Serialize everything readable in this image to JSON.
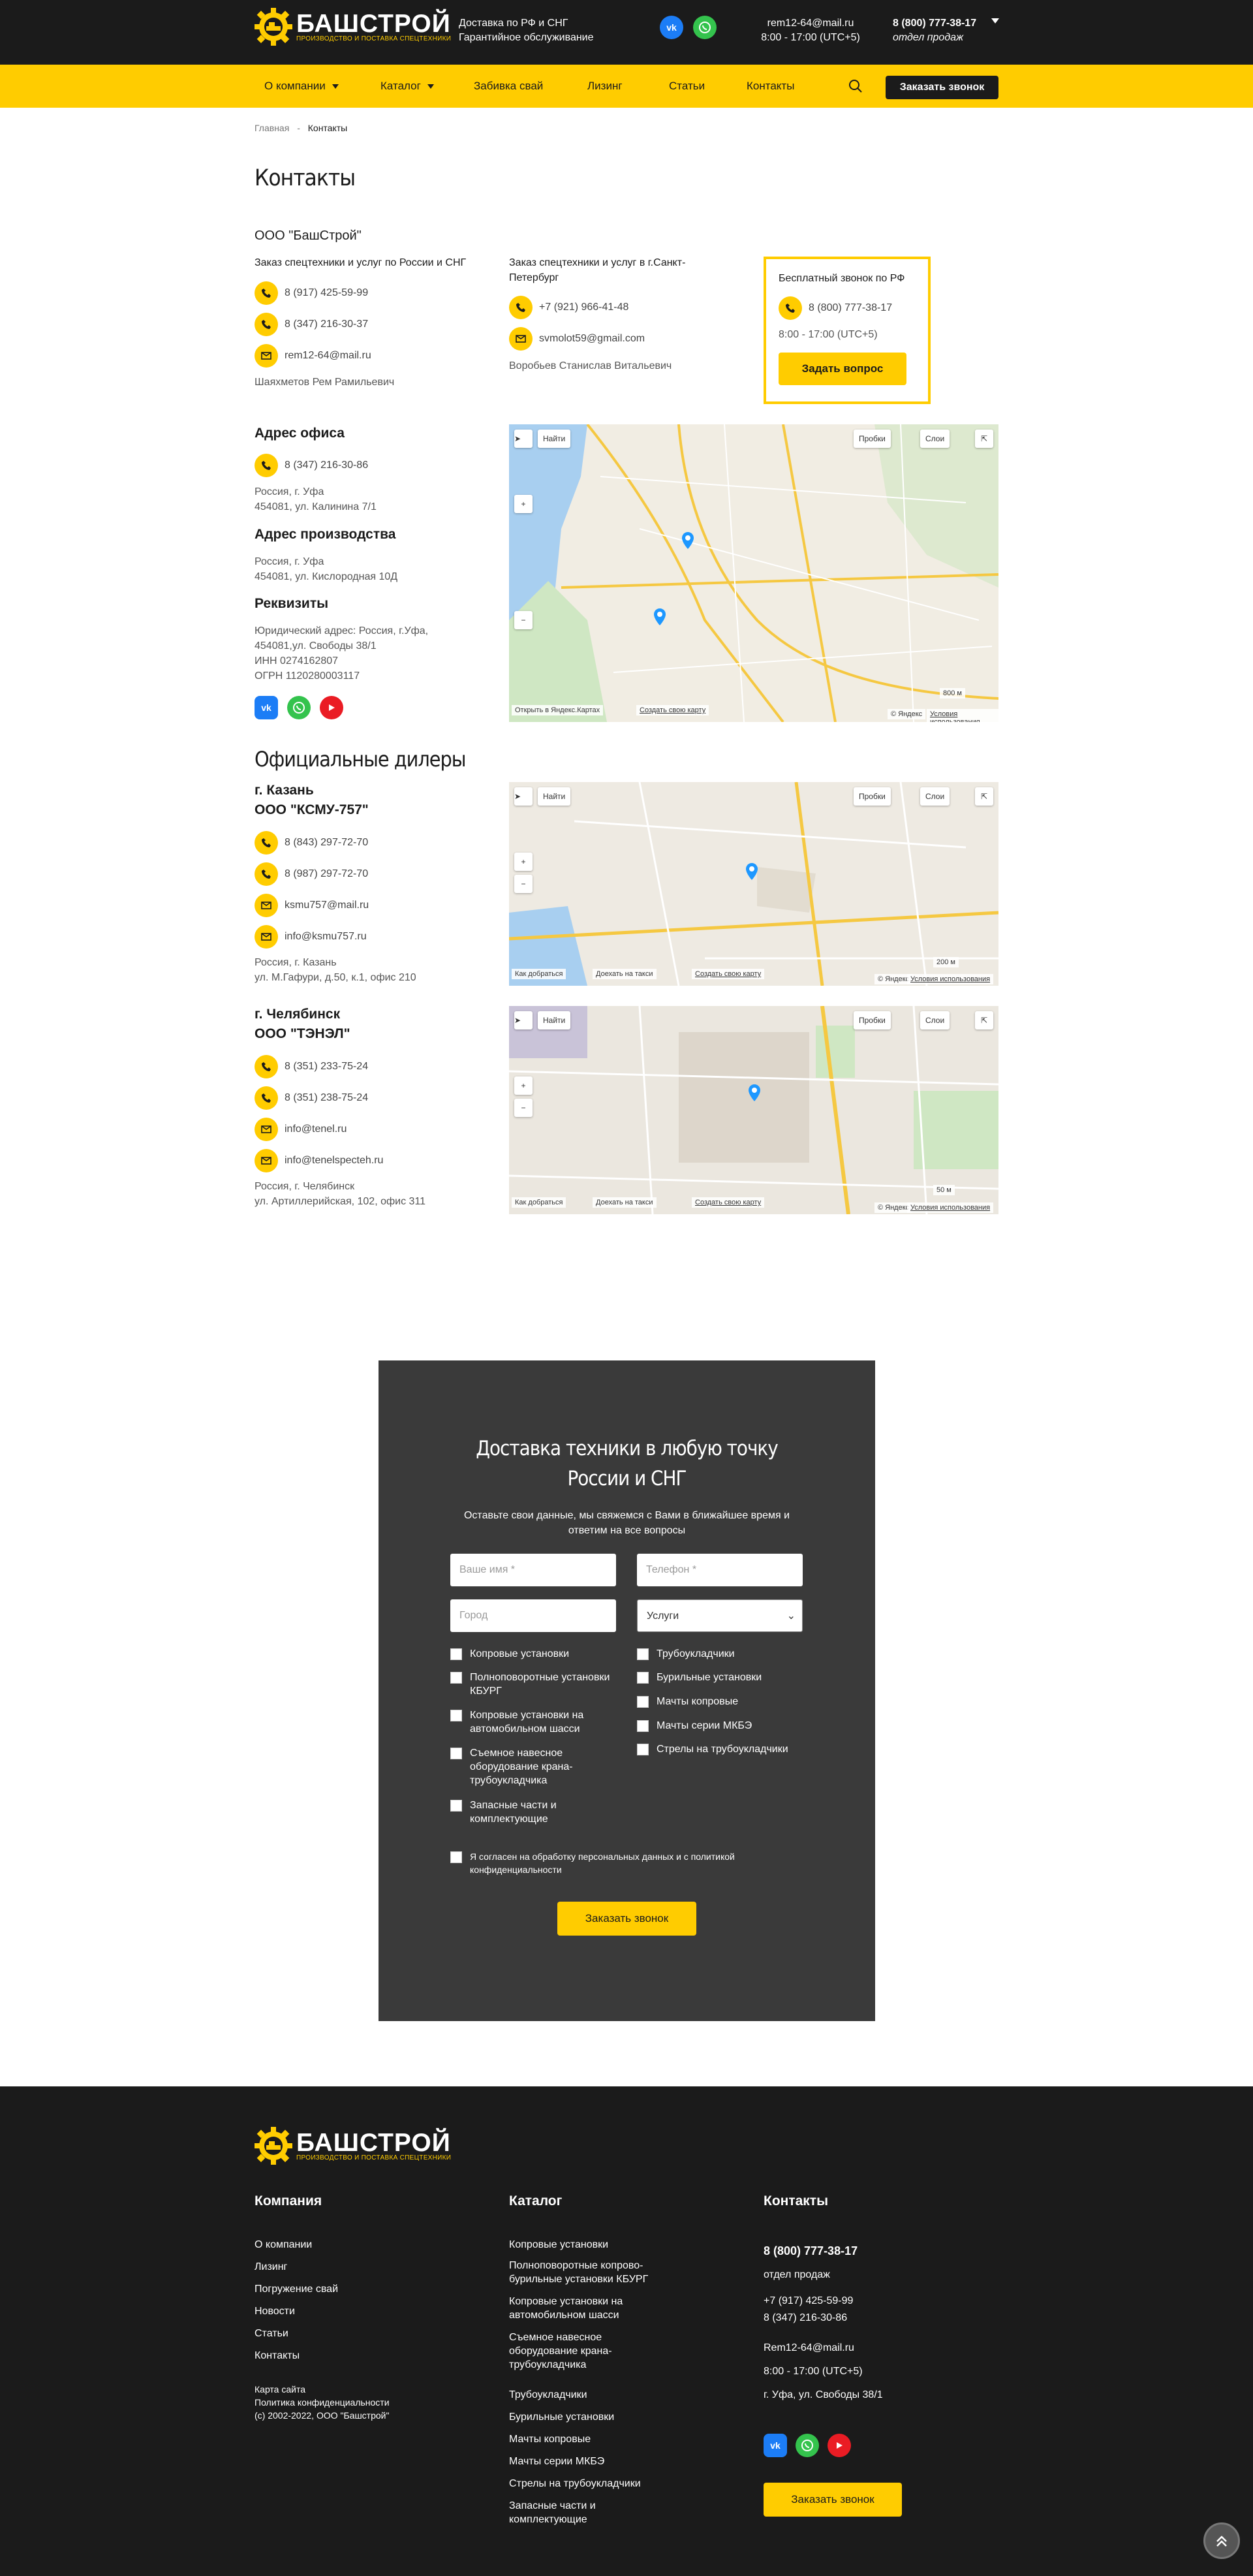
{
  "brand": {
    "name": "БАШСТРОЙ",
    "tagline": "ПРОИЗВОДСТВО И ПОСТАВКА СПЕЦТЕХНИКИ",
    "accent": "#ffcc00",
    "dark": "#1b1b1b"
  },
  "header": {
    "delivery_line1": "Доставка по РФ и СНГ",
    "delivery_line2": "Гарантийное обслуживание",
    "email": "rem12-64@mail.ru",
    "hours": "8:00 - 17:00 (UTC+5)",
    "phone": "8 (800) 777-38-17",
    "phone_note": "отдел продаж"
  },
  "nav": {
    "items": [
      "О компании",
      "Каталог",
      "Забивка свай",
      "Лизинг",
      "Статьи",
      "Контакты"
    ],
    "callback": "Заказать звонок"
  },
  "breadcrumb": {
    "home": "Главная",
    "sep": "-",
    "current": "Контакты"
  },
  "page_title": "Контакты",
  "company": {
    "name": "ООО \"БашСтрой\"",
    "col1": {
      "title": "Заказ спецтехники и услуг по России и СНГ",
      "phone1": "8 (917) 425-59-99",
      "phone2": "8 (347) 216-30-37",
      "email": "rem12-64@mail.ru",
      "person": "Шаяхметов Рем Рамильевич"
    },
    "col2": {
      "title": "Заказ спецтехники и услуг в г.Санкт-Петербург",
      "phone": "+7 (921) 966-41-48",
      "email": "svmolot59@gmail.com",
      "person": "Воробьев Станислав Витальевич"
    },
    "free": {
      "title": "Бесплатный звонок по РФ",
      "phone": "8 (800) 777-38-17",
      "hours": "8:00 - 17:00 (UTC+5)",
      "button": "Задать вопрос"
    }
  },
  "office": {
    "title": "Адрес офиса",
    "phone": "8 (347) 216-30-86",
    "line1": "Россия, г. Уфа",
    "line2": "454081, ул. Калинина 7/1"
  },
  "production": {
    "title": "Адрес производства",
    "line1": "Россия, г. Уфа",
    "line2": "454081, ул. Кислородная 10Д"
  },
  "requisites": {
    "title": "Реквизиты",
    "line1": "Юридический адрес: Россия, г.Уфа,",
    "line2": "454081,ул. Свободы 38/1",
    "line3": "ИНН 0274162807",
    "line4": "ОГРН 1120280003117"
  },
  "map": {
    "find": "Найти",
    "traffic": "Пробки",
    "layers": "Слои",
    "open_yandex": "Открыть в Яндекс.Картах",
    "create": "Создать свою карту",
    "route": "Как добраться",
    "taxi": "Доехать на такси",
    "copyright": "© Яндекс",
    "terms": "Условия использования",
    "scale1": "800 м",
    "scale2": "200 м",
    "scale3": "50 м"
  },
  "dealers": {
    "title": "Официальные дилеры",
    "kazan": {
      "city": "г. Казань",
      "name": "ООО \"КСМУ-757\"",
      "phone1": "8 (843) 297-72-70",
      "phone2": "8 (987) 297-72-70",
      "email1": "ksmu757@mail.ru",
      "email2": "info@ksmu757.ru",
      "line1": "Россия, г. Казань",
      "line2": "ул. М.Гафури, д.50, к.1, офис 210"
    },
    "chel": {
      "city": "г. Челябинск",
      "name": "ООО \"ТЭНЭЛ\"",
      "phone1": "8 (351) 233-75-24",
      "phone2": "8 (351) 238-75-24",
      "email1": "info@tenel.ru",
      "email2": "info@tenelspecteh.ru",
      "line1": "Россия, г. Челябинск",
      "line2": "ул. Артиллерийская, 102, офис 311"
    }
  },
  "form": {
    "title": "Доставка техники в любую точку России и СНГ",
    "subtitle": "Оставьте свои данные, мы свяжемся с Вами в ближайшее время и ответим на все вопросы",
    "name_ph": "Ваше имя *",
    "phone_ph": "Телефон *",
    "city_ph": "Город",
    "service": "Услуги",
    "left": [
      "Копровые установки",
      "Полноповоротные установки КБУРГ",
      "Копровые установки на автомобильном шасси",
      "Съемное навесное оборудование крана-трубоукладчика",
      "Запасные части и комплектующие"
    ],
    "right": [
      "Трубоукладчики",
      "Бурильные установки",
      "Мачты копровые",
      "Мачты серии МКБЭ",
      "Стрелы на трубоукладчики"
    ],
    "consent": "Я согласен на обработку персональных данных и с политикой конфиденциальности",
    "submit": "Заказать звонок"
  },
  "footer": {
    "company_title": "Компания",
    "company_links": [
      "О компании",
      "Лизинг",
      "Погружение свай",
      "Новости",
      "Статьи",
      "Контакты"
    ],
    "sitemap": "Карта сайта",
    "privacy": "Политика конфиденциальности",
    "copyright": "(с) 2002-2022, ООО \"Башстрой\"",
    "catalog_title": "Каталог",
    "catalog_links": [
      "Копровые установки",
      "Полноповоротные копрово-бурильные установки КБУРГ",
      "Копровые установки на автомобильном шасси",
      "Съемное навесное оборудование крана-трубоукладчика",
      "Трубоукладчики",
      "Бурильные установки",
      "Мачты копровые",
      "Мачты серии МКБЭ",
      "Стрелы на трубоукладчики",
      "Запасные части и комплектующие"
    ],
    "contacts_title": "Контакты",
    "phone": "8 (800) 777-38-17",
    "phone_note": "отдел продаж",
    "phone2": "+7 (917) 425-59-99",
    "phone3": "8 (347) 216-30-86",
    "email": "Rem12-64@mail.ru",
    "hours": "8:00 - 17:00 (UTC+5)",
    "address": "г. Уфа, ул. Свободы 38/1",
    "callback": "Заказать звонок"
  }
}
